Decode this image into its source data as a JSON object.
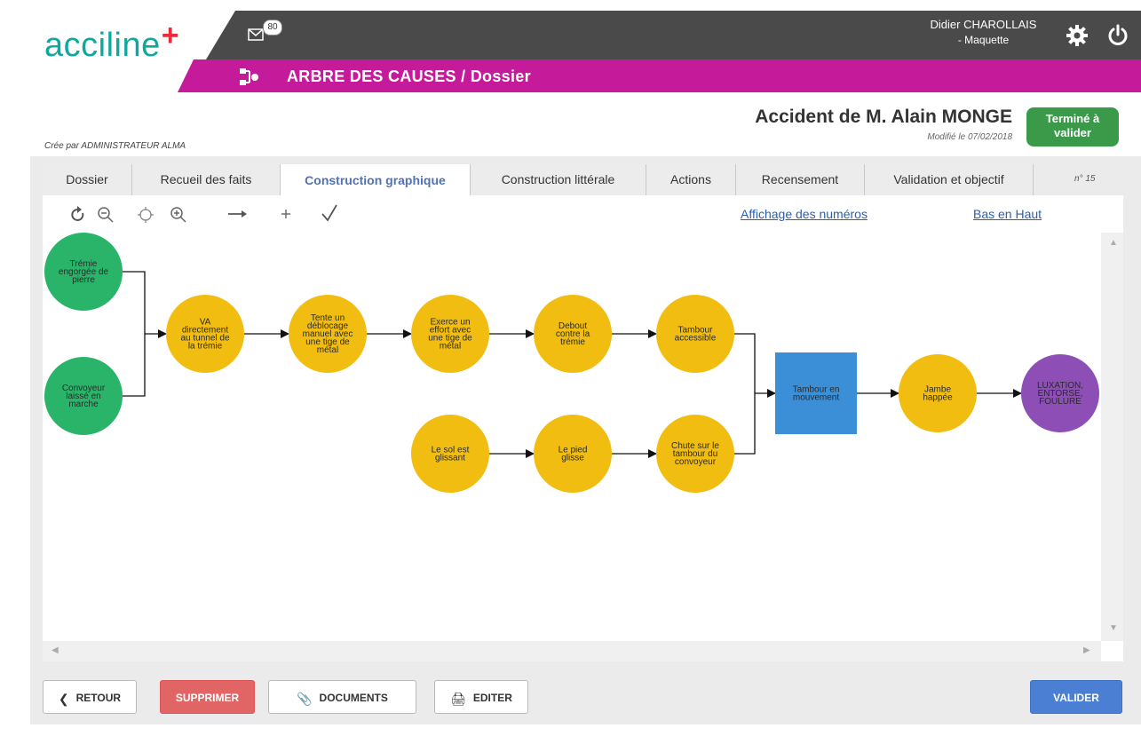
{
  "app": {
    "logo_text": "acciline",
    "logo_plus": "+",
    "mail_count": "80",
    "user_name": "Didier CHAROLLAIS",
    "user_sub": "- Maquette",
    "module_title": "ARBRE DES CAUSES",
    "module_sub": "/ Dossier"
  },
  "header": {
    "accident_title": "Accident de M. Alain MONGE",
    "modified": "Modifié le 07/02/2018",
    "created": "Crée par ADMINISTRATEUR ALMA",
    "status_line1": "Terminé à",
    "status_line2": "valider",
    "status_color": "#3a9a4a"
  },
  "tabs": [
    {
      "label": "Dossier"
    },
    {
      "label": "Recueil des faits"
    },
    {
      "label": "Construction graphique",
      "active": true
    },
    {
      "label": "Construction littérale"
    },
    {
      "label": "Actions"
    },
    {
      "label": "Recensement"
    },
    {
      "label": "Validation et objectif"
    }
  ],
  "tab_number": "n° 15",
  "toolbar": {
    "tools": [
      "refresh-icon",
      "zoom-out-icon",
      "center-icon",
      "zoom-in-icon",
      "arrow-icon",
      "add-icon",
      "check-icon"
    ],
    "link_numbers": "Affichage des numéros",
    "link_direction": "Bas en Haut"
  },
  "diagram": {
    "colors": {
      "fact_root": "#2ab46a",
      "fact": "#f0bd10",
      "event": "#3a8fd6",
      "injury": "#8d4fb5"
    },
    "nodes": [
      {
        "id": "n1",
        "kind": "fact_root",
        "lines": [
          "Trémie",
          "engorgée de",
          "pierre"
        ]
      },
      {
        "id": "n2",
        "kind": "fact_root",
        "lines": [
          "Convoyeur",
          "laissé en",
          "marche"
        ]
      },
      {
        "id": "n3",
        "kind": "fact",
        "lines": [
          "VA",
          "directement",
          "au tunnel de",
          "la trémie"
        ]
      },
      {
        "id": "n4",
        "kind": "fact",
        "lines": [
          "Tente un",
          "déblocage",
          "manuel avec",
          "une tige de",
          "métal"
        ]
      },
      {
        "id": "n5",
        "kind": "fact",
        "lines": [
          "Exerce un",
          "effort avec",
          "une tige de",
          "métal"
        ]
      },
      {
        "id": "n6",
        "kind": "fact",
        "lines": [
          "Debout",
          "contre la",
          "trémie"
        ]
      },
      {
        "id": "n7",
        "kind": "fact",
        "lines": [
          "Tambour",
          "accessible"
        ]
      },
      {
        "id": "n8",
        "kind": "fact",
        "lines": [
          "Le sol est",
          "glissant"
        ]
      },
      {
        "id": "n9",
        "kind": "fact",
        "lines": [
          "Le pied",
          "glisse"
        ]
      },
      {
        "id": "n10",
        "kind": "fact",
        "lines": [
          "Chute sur le",
          "tambour du",
          "convoyeur"
        ]
      },
      {
        "id": "n11",
        "kind": "event",
        "lines": [
          "Tambour en",
          "mouvement"
        ]
      },
      {
        "id": "n12",
        "kind": "fact",
        "lines": [
          "Jambe",
          "happée"
        ]
      },
      {
        "id": "n13",
        "kind": "injury",
        "lines": [
          "LUXATION,",
          "ENTORSE,",
          "FOULURE"
        ]
      }
    ]
  },
  "buttons": {
    "retour": "RETOUR",
    "supprimer": "SUPPRIMER",
    "documents": "DOCUMENTS",
    "editer": "EDITER",
    "valider": "VALIDER"
  }
}
